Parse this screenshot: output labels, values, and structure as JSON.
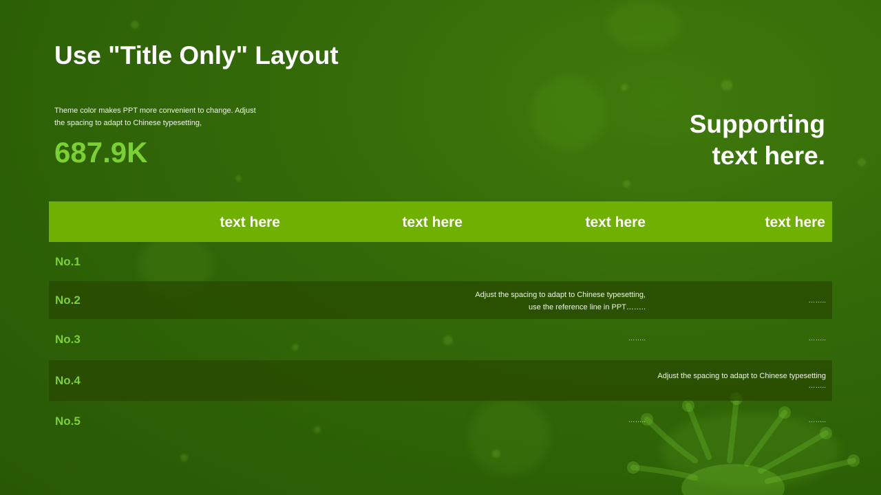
{
  "slide": {
    "title": "Use \"Title Only\" Layout",
    "description": "Theme color makes PPT more convenient  to change. Adjust the spacing to adapt to Chinese typesetting,",
    "big_number": "687.9K",
    "supporting_line1": "Supporting",
    "supporting_line2": "text here."
  },
  "table": {
    "headers": [
      "text here",
      "text here",
      "text here",
      "text here"
    ],
    "rows": [
      {
        "label": "No.1",
        "col3": "",
        "col4": ""
      },
      {
        "label": "No.2",
        "col3_line1": "Adjust the spacing to adapt to Chinese typesetting,",
        "col3_line2": "use the reference line in PPT……..",
        "col4": "……..",
        "col3": "",
        "col4_sub": ""
      },
      {
        "label": "No.3",
        "col3": "……..",
        "col4": "…….."
      },
      {
        "label": "No.4",
        "col4_line1": "Adjust the spacing to adapt to Chinese typesetting",
        "col4_sub": "……..",
        "col3": ""
      },
      {
        "label": "No.5",
        "col3": "……..",
        "col4": "…….."
      }
    ]
  },
  "colors": {
    "background": "#336a08",
    "header_band": "#70b000",
    "accent": "#7bd034",
    "row_shade": "#284800"
  }
}
